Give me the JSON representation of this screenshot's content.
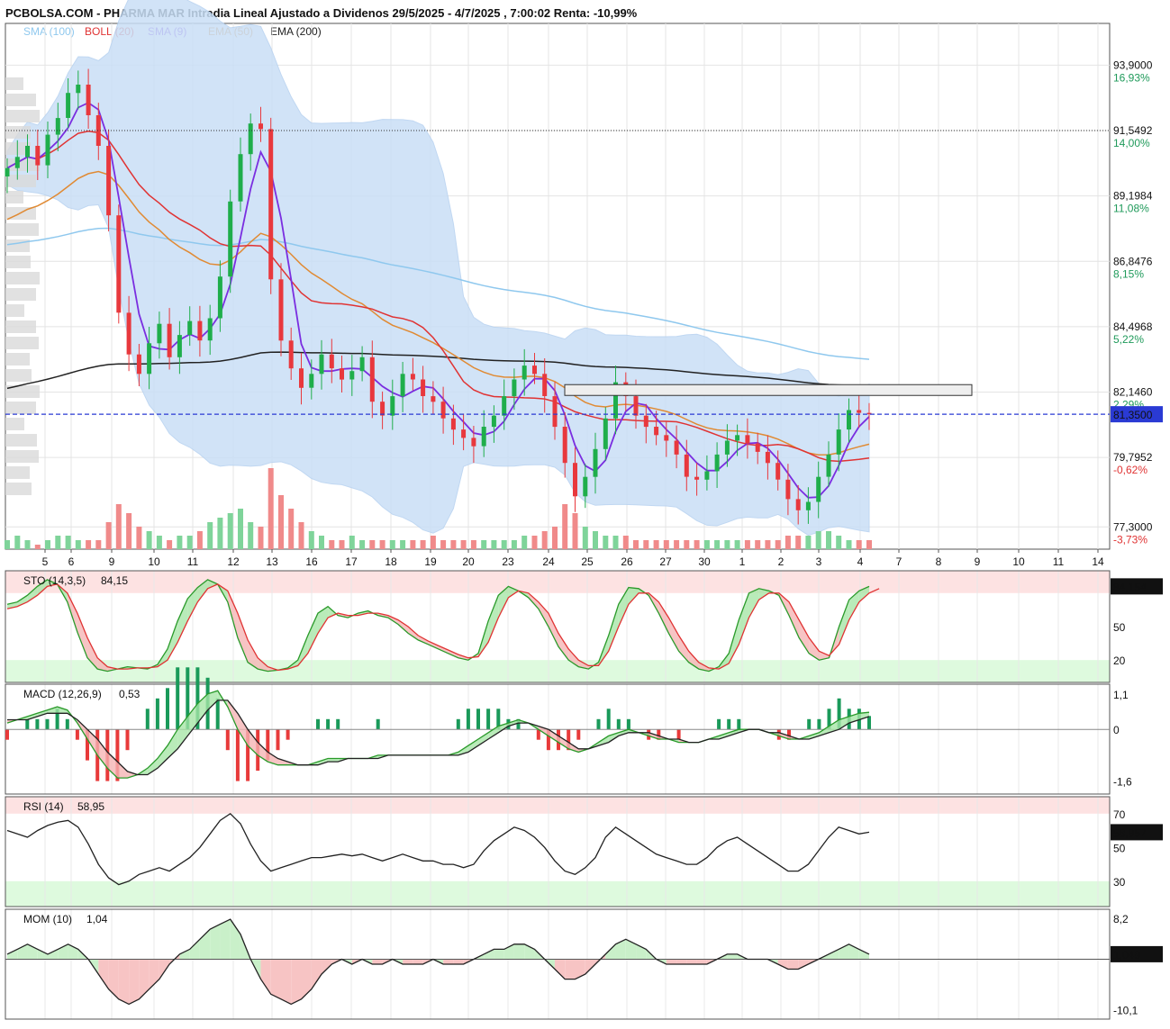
{
  "chart_data": {
    "type": "candlestick",
    "title": "PCBOLSA.COM - PHARMA MAR Intradia Lineal Ajustado a Dividenos 29/5/2025 - 4/7/2025 , 7:00:02 Renta: -10,99%",
    "legend": [
      {
        "label": "SMA (100)",
        "color": "#8fc8ee"
      },
      {
        "label": "BOLL (20)",
        "color": "#e03333"
      },
      {
        "label": "SMA (9)",
        "color": "#7a2ee0"
      },
      {
        "label": "EMA (50)",
        "color": "#e08a33"
      },
      {
        "label": "EMA (200)",
        "color": "#222222"
      }
    ],
    "x_labels": [
      "5",
      "6",
      "9",
      "10",
      "11",
      "12",
      "13",
      "16",
      "17",
      "18",
      "19",
      "20",
      "23",
      "24",
      "25",
      "26",
      "27",
      "30",
      "1",
      "2",
      "3",
      "4",
      "7",
      "8",
      "9",
      "10",
      "11",
      "14"
    ],
    "price_axis": {
      "min": 76.5,
      "max": 95.4
    },
    "price_labels": [
      {
        "price": "93,9000",
        "pct": "16,93%",
        "pct_color": "#1f9a5a"
      },
      {
        "price": "91,5492",
        "pct": "14,00%",
        "pct_color": "#1f9a5a"
      },
      {
        "price": "89,1984",
        "pct": "11,08%",
        "pct_color": "#1f9a5a"
      },
      {
        "price": "86,8476",
        "pct": "8,15%",
        "pct_color": "#1f9a5a"
      },
      {
        "price": "84,4968",
        "pct": "5,22%",
        "pct_color": "#1f9a5a"
      },
      {
        "price": "82,1460",
        "pct": "2,29%",
        "pct_color": "#1f9a5a"
      },
      {
        "price": "79,7952",
        "pct": "-0,62%",
        "pct_color": "#e03333"
      },
      {
        "price": "77,3000",
        "pct": "-3,73%",
        "pct_color": "#e03333"
      }
    ],
    "current_price": {
      "value": 81.35,
      "label": "81,3500"
    },
    "reference_price": 91.55,
    "resistance_box": {
      "x_from": "24",
      "x_to": "9",
      "price_low": 82.18,
      "price_high": 82.35
    },
    "close_series": [
      90.2,
      90.6,
      91.0,
      90.3,
      91.4,
      92.0,
      92.9,
      93.2,
      92.1,
      91.0,
      88.5,
      85.0,
      83.5,
      82.8,
      83.9,
      84.6,
      83.4,
      84.2,
      84.7,
      84.0,
      84.8,
      86.3,
      89.0,
      90.7,
      91.8,
      91.6,
      86.2,
      84.0,
      83.0,
      82.3,
      82.8,
      83.5,
      83.0,
      82.6,
      82.9,
      83.4,
      81.8,
      81.3,
      82.0,
      82.8,
      82.6,
      82.0,
      81.8,
      81.2,
      80.8,
      80.5,
      80.2,
      80.9,
      81.3,
      82.0,
      82.6,
      83.1,
      82.8,
      82.0,
      80.9,
      79.6,
      78.4,
      79.1,
      80.1,
      81.2,
      82.5,
      82.0,
      81.3,
      80.9,
      80.6,
      80.4,
      79.9,
      79.1,
      79.0,
      79.3,
      79.9,
      80.4,
      80.6,
      80.3,
      80.0,
      79.6,
      79.0,
      78.3,
      77.9,
      78.2,
      79.1,
      79.9,
      80.8,
      81.5,
      81.4,
      81.35
    ],
    "volume_series": [
      2,
      3,
      2,
      1,
      2,
      3,
      3,
      2,
      2,
      2,
      6,
      10,
      8,
      5,
      4,
      3,
      2,
      3,
      3,
      4,
      6,
      7,
      8,
      9,
      6,
      5,
      18,
      12,
      9,
      6,
      4,
      3,
      2,
      2,
      3,
      2,
      2,
      2,
      2,
      2,
      2,
      2,
      3,
      2,
      2,
      2,
      2,
      2,
      2,
      2,
      2,
      3,
      3,
      4,
      5,
      10,
      8,
      5,
      4,
      3,
      3,
      3,
      2,
      2,
      2,
      2,
      2,
      2,
      2,
      2,
      2,
      2,
      2,
      2,
      2,
      2,
      2,
      3,
      3,
      3,
      4,
      4,
      3,
      2,
      2,
      2
    ],
    "panels": [
      {
        "name": "STO (14,3,5)",
        "value_label": "84,15",
        "current_label": "84,154",
        "levels": [
          {
            "v": 80,
            "label": ""
          },
          {
            "v": 50,
            "label": "50"
          },
          {
            "v": 20,
            "label": "20"
          }
        ],
        "range": [
          0,
          100
        ],
        "series_k": [
          70,
          72,
          78,
          86,
          92,
          88,
          72,
          45,
          22,
          12,
          10,
          12,
          14,
          13,
          12,
          16,
          30,
          55,
          75,
          85,
          92,
          88,
          72,
          40,
          18,
          12,
          10,
          11,
          13,
          20,
          42,
          62,
          68,
          60,
          58,
          62,
          64,
          60,
          58,
          52,
          44,
          38,
          34,
          30,
          26,
          22,
          20,
          26,
          55,
          78,
          86,
          82,
          76,
          66,
          50,
          32,
          20,
          14,
          12,
          18,
          42,
          70,
          85,
          84,
          78,
          62,
          44,
          28,
          18,
          12,
          10,
          14,
          26,
          56,
          80,
          84,
          82,
          78,
          60,
          40,
          26,
          20,
          22,
          50,
          74,
          82,
          86
        ],
        "series_d": [
          66,
          68,
          72,
          78,
          86,
          88,
          80,
          62,
          40,
          22,
          14,
          12,
          12,
          13,
          13,
          14,
          20,
          36,
          55,
          72,
          84,
          88,
          82,
          62,
          38,
          22,
          14,
          11,
          12,
          15,
          26,
          44,
          58,
          62,
          60,
          60,
          62,
          62,
          60,
          56,
          50,
          42,
          37,
          33,
          29,
          25,
          22,
          23,
          36,
          58,
          76,
          82,
          80,
          72,
          62,
          44,
          30,
          20,
          15,
          15,
          28,
          50,
          70,
          80,
          80,
          72,
          58,
          42,
          28,
          18,
          13,
          12,
          17,
          34,
          58,
          74,
          80,
          80,
          72,
          56,
          40,
          28,
          24,
          34,
          56,
          72,
          80,
          84
        ]
      },
      {
        "name": "MACD (12,26,9)",
        "value_label": "0,53",
        "levels": [
          {
            "v": 1.1,
            "label": "1,1"
          },
          {
            "v": 0,
            "label": "0"
          },
          {
            "v": -1.6,
            "label": "-1,6"
          }
        ],
        "range": [
          -2.0,
          1.4
        ],
        "series_macd": [
          0.2,
          0.3,
          0.4,
          0.5,
          0.6,
          0.7,
          0.6,
          0.2,
          -0.3,
          -0.8,
          -1.2,
          -1.5,
          -1.5,
          -1.4,
          -1.2,
          -0.9,
          -0.5,
          0.0,
          0.4,
          0.8,
          1.1,
          1.2,
          0.7,
          0.0,
          -0.5,
          -0.8,
          -1.0,
          -1.1,
          -1.1,
          -1.1,
          -1.1,
          -1.0,
          -0.9,
          -0.9,
          -0.9,
          -0.9,
          -0.9,
          -0.8,
          -0.8,
          -0.8,
          -0.8,
          -0.8,
          -0.8,
          -0.8,
          -0.8,
          -0.7,
          -0.5,
          -0.3,
          -0.1,
          0.1,
          0.2,
          0.3,
          0.2,
          0.0,
          -0.2,
          -0.4,
          -0.6,
          -0.7,
          -0.6,
          -0.4,
          -0.2,
          -0.1,
          0.0,
          -0.1,
          -0.2,
          -0.3,
          -0.3,
          -0.4,
          -0.4,
          -0.4,
          -0.3,
          -0.2,
          -0.1,
          0.0,
          0.0,
          0.0,
          -0.1,
          -0.2,
          -0.3,
          -0.3,
          -0.2,
          -0.1,
          0.1,
          0.3,
          0.4,
          0.5,
          0.53
        ],
        "series_signal": [
          0.3,
          0.3,
          0.3,
          0.4,
          0.5,
          0.5,
          0.5,
          0.3,
          0.0,
          -0.3,
          -0.7,
          -1.0,
          -1.3,
          -1.4,
          -1.4,
          -1.2,
          -0.9,
          -0.6,
          -0.2,
          0.2,
          0.6,
          0.9,
          0.9,
          0.5,
          0.0,
          -0.4,
          -0.7,
          -0.9,
          -1.0,
          -1.1,
          -1.1,
          -1.1,
          -1.0,
          -1.0,
          -0.9,
          -0.9,
          -0.9,
          -0.9,
          -0.8,
          -0.8,
          -0.8,
          -0.8,
          -0.8,
          -0.8,
          -0.8,
          -0.8,
          -0.7,
          -0.5,
          -0.3,
          -0.1,
          0.1,
          0.2,
          0.2,
          0.1,
          0.0,
          -0.2,
          -0.4,
          -0.6,
          -0.6,
          -0.5,
          -0.4,
          -0.2,
          -0.1,
          -0.1,
          -0.1,
          -0.2,
          -0.3,
          -0.3,
          -0.4,
          -0.4,
          -0.3,
          -0.3,
          -0.2,
          -0.1,
          0.0,
          0.0,
          -0.1,
          -0.1,
          -0.2,
          -0.3,
          -0.3,
          -0.2,
          -0.1,
          0.0,
          0.2,
          0.3,
          0.4
        ]
      },
      {
        "name": "RSI (14)",
        "value_label": "58,95",
        "current_label": "58,957",
        "levels": [
          {
            "v": 70,
            "label": "70"
          },
          {
            "v": 50,
            "label": "50"
          },
          {
            "v": 30,
            "label": "30"
          }
        ],
        "range": [
          15,
          80
        ],
        "series": [
          60,
          58,
          56,
          60,
          63,
          65,
          66,
          62,
          52,
          40,
          32,
          28,
          30,
          34,
          36,
          38,
          36,
          40,
          44,
          50,
          58,
          66,
          70,
          64,
          52,
          42,
          36,
          38,
          40,
          42,
          44,
          44,
          45,
          46,
          45,
          46,
          44,
          42,
          44,
          46,
          44,
          42,
          42,
          40,
          40,
          38,
          40,
          48,
          54,
          58,
          62,
          60,
          56,
          50,
          42,
          36,
          34,
          38,
          44,
          56,
          62,
          58,
          54,
          50,
          46,
          44,
          42,
          40,
          40,
          44,
          50,
          54,
          56,
          52,
          48,
          44,
          40,
          36,
          36,
          40,
          48,
          56,
          62,
          60,
          58,
          59
        ]
      },
      {
        "name": "MOM (10)",
        "value_label": "1,04",
        "current_label": "1,049",
        "levels": [
          {
            "v": 8.2,
            "label": "8,2"
          },
          {
            "v": 0,
            "label": ""
          },
          {
            "v": -10.1,
            "label": "-10,1"
          }
        ],
        "range": [
          -12,
          10
        ],
        "series": [
          1,
          2,
          3,
          2,
          1,
          2,
          3,
          2,
          0,
          -3,
          -6,
          -8,
          -9,
          -8,
          -6,
          -4,
          -1,
          1,
          2,
          4,
          6,
          7,
          8,
          5,
          0,
          -4,
          -7,
          -8,
          -9,
          -8,
          -6,
          -3,
          -1,
          0,
          -1,
          0,
          -1,
          -1,
          0,
          -1,
          -1,
          -1,
          0,
          -1,
          -1,
          -1,
          0,
          1,
          2,
          2,
          3,
          3,
          2,
          0,
          -2,
          -4,
          -4,
          -3,
          -1,
          1,
          3,
          4,
          3,
          2,
          0,
          -1,
          -1,
          -1,
          -1,
          -1,
          0,
          1,
          1,
          0,
          0,
          0,
          -1,
          -2,
          -2,
          -1,
          0,
          1,
          2,
          3,
          2,
          1
        ]
      }
    ]
  }
}
